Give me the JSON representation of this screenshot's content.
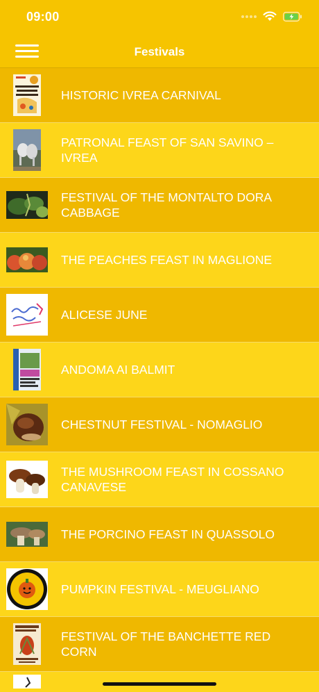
{
  "status_bar": {
    "time": "09:00"
  },
  "nav": {
    "title": "Festivals"
  },
  "festivals": [
    {
      "label": "HISTORIC IVREA CARNIVAL",
      "icon": "carnival-poster-thumbnail"
    },
    {
      "label": "PATRONAL FEAST OF SAN SAVINO – IVREA",
      "icon": "horses-thumbnail"
    },
    {
      "label": "FESTIVAL OF THE MONTALTO DORA CABBAGE",
      "icon": "cabbage-thumbnail"
    },
    {
      "label": "THE PEACHES FEAST IN MAGLIONE",
      "icon": "peaches-thumbnail"
    },
    {
      "label": "ALICESE JUNE",
      "icon": "giugno-alicese-logo-thumbnail"
    },
    {
      "label": "ANDOMA AI BALMIT",
      "icon": "andoma-poster-thumbnail"
    },
    {
      "label": "CHESTNUT FESTIVAL - NOMAGLIO",
      "icon": "chestnuts-thumbnail"
    },
    {
      "label": "THE MUSHROOM FEAST IN COSSANO CANAVESE",
      "icon": "mushrooms-thumbnail"
    },
    {
      "label": "THE PORCINO FEAST IN QUASSOLO",
      "icon": "porcino-thumbnail"
    },
    {
      "label": "PUMPKIN FESTIVAL - MEUGLIANO",
      "icon": "proloco-meugliano-logo-thumbnail"
    },
    {
      "label": "FESTIVAL OF THE BANCHETTE RED CORN",
      "icon": "red-corn-poster-thumbnail"
    }
  ]
}
